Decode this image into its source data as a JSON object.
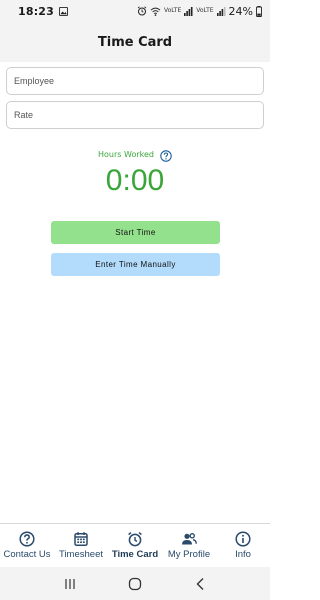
{
  "status_bar": {
    "time": "18:23",
    "battery_percent": "24%",
    "network_label_1": "VoLTE",
    "network_label_2": "VoLTE"
  },
  "header": {
    "title": "Time Card"
  },
  "form": {
    "employee_placeholder": "Employee",
    "rate_placeholder": "Rate"
  },
  "hours": {
    "label": "Hours Worked",
    "value": "0:00"
  },
  "buttons": {
    "start_time": "Start Time",
    "enter_manually": "Enter Time Manually"
  },
  "bottom_nav": {
    "items": [
      {
        "label": "Contact Us",
        "icon": "help-circle-icon"
      },
      {
        "label": "Timesheet",
        "icon": "calendar-icon"
      },
      {
        "label": "Time Card",
        "icon": "alarm-clock-icon",
        "active": true
      },
      {
        "label": "My Profile",
        "icon": "people-icon"
      },
      {
        "label": "Info",
        "icon": "info-icon"
      }
    ]
  },
  "colors": {
    "accent_green": "#3aa63a",
    "start_button": "#93e08d",
    "manual_button": "#b3dcfc",
    "nav_icon": "#2a4a6a"
  }
}
